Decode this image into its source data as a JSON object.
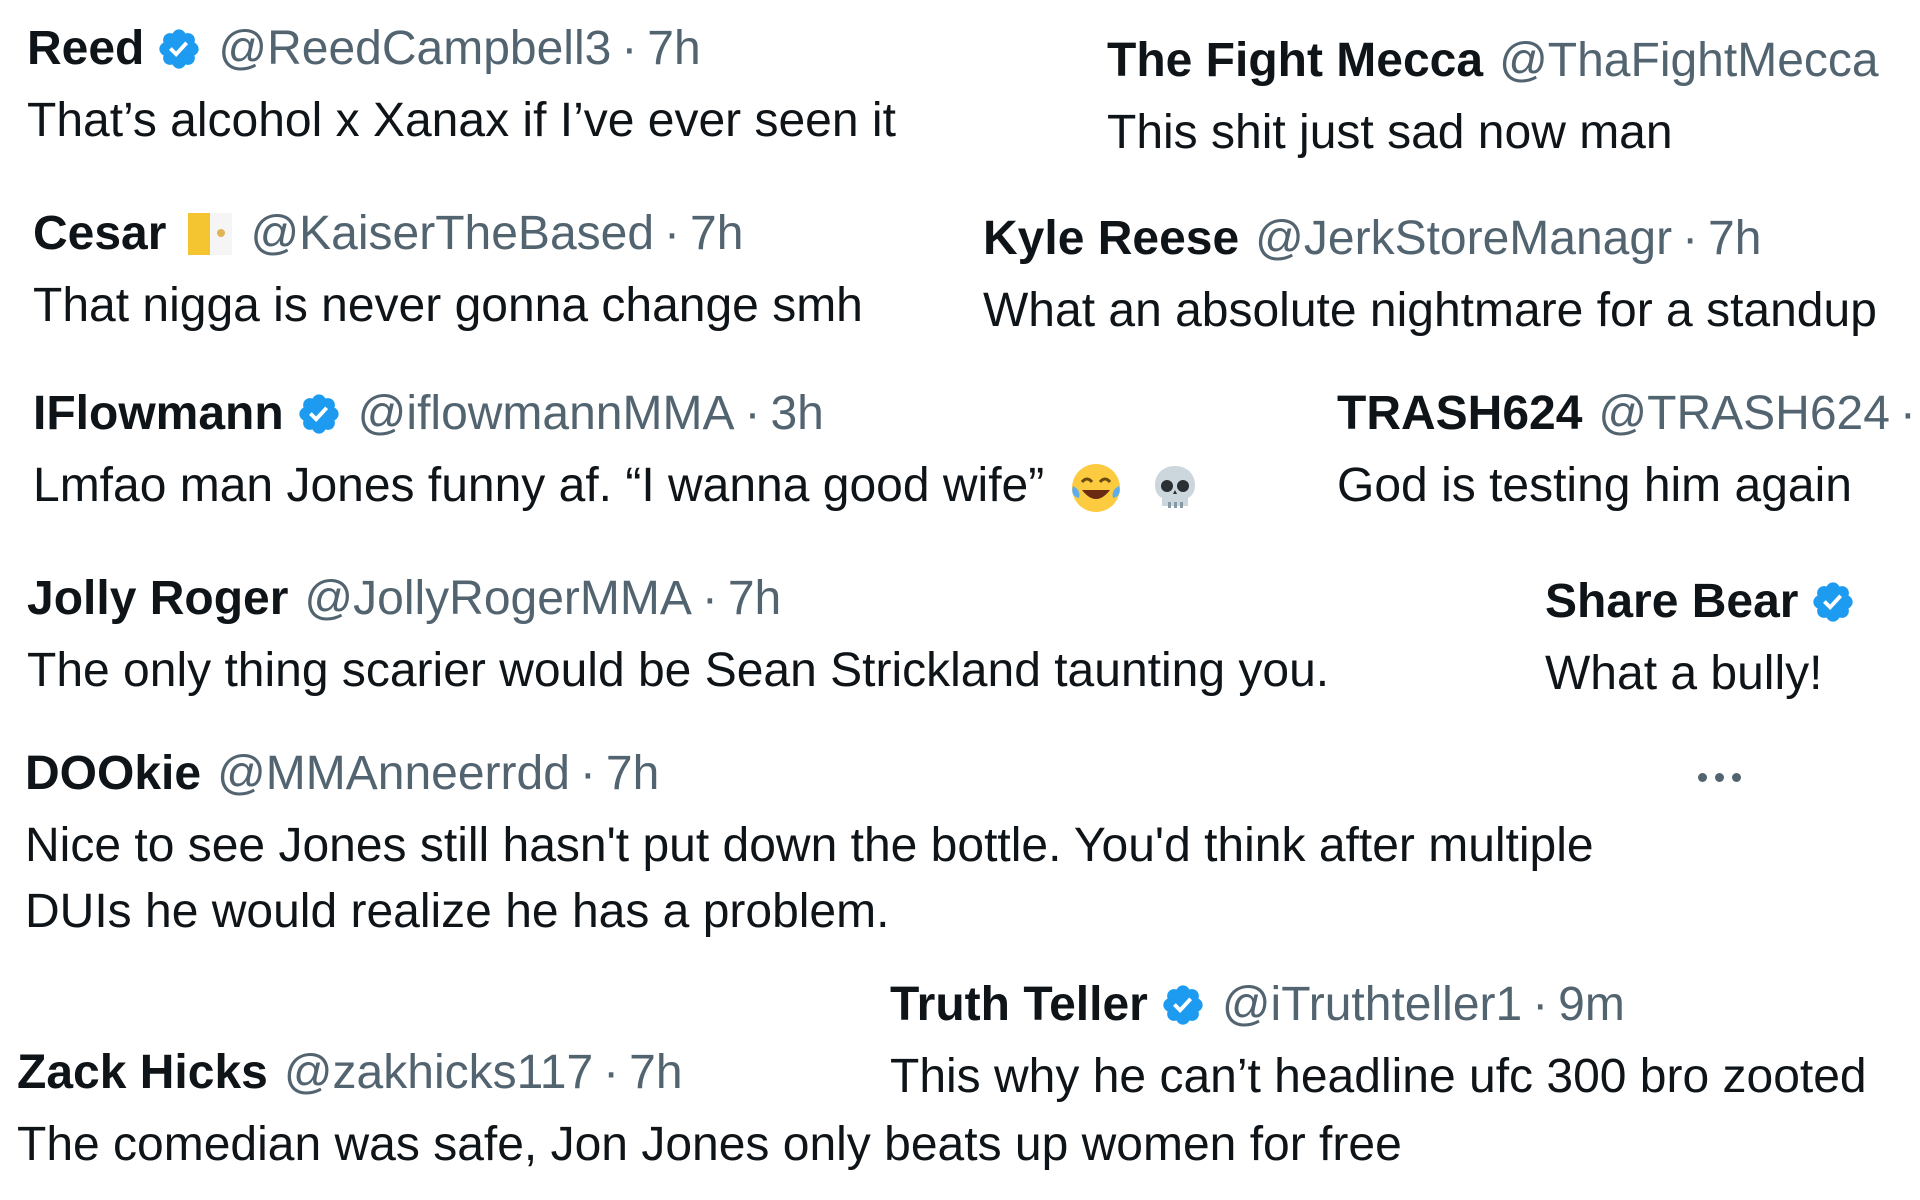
{
  "tweets": [
    {
      "name": "Reed",
      "verified": true,
      "handle": "@ReedCampbell3",
      "sep": "·",
      "time": "7h",
      "text": "That’s alcohol x Xanax if I’ve ever seen it"
    },
    {
      "name": "The Fight Mecca",
      "verified": false,
      "handle": "@ThaFightMecca",
      "text": "This shit just sad now man"
    },
    {
      "name": "Cesar",
      "verified": false,
      "flag": "vatican-flag-icon",
      "handle": "@KaiserTheBased",
      "sep": "·",
      "time": "7h",
      "text": "That nigga is never gonna change smh"
    },
    {
      "name": "Kyle Reese",
      "verified": false,
      "handle": "@JerkStoreManagr",
      "sep": "·",
      "time": "7h",
      "text": "What an absolute nightmare for a standup"
    },
    {
      "name": "IFlowmann",
      "verified": true,
      "handle": "@iflowmannMMA",
      "sep": "·",
      "time": "3h",
      "text": "Lmfao man Jones funny af. “I wanna good wife”",
      "emojis": [
        "tears-of-joy-emoji-icon",
        "skull-emoji-icon"
      ]
    },
    {
      "name": "TRASH624",
      "verified": false,
      "handle": "@TRASH624",
      "sep": "·",
      "text": "God is testing him again"
    },
    {
      "name": "Jolly Roger",
      "verified": false,
      "handle": "@JollyRogerMMA",
      "sep": "·",
      "time": "7h",
      "text": "The only thing scarier would be Sean Strickland taunting you."
    },
    {
      "name": "Share Bear",
      "verified": true,
      "text": "What a bully!"
    },
    {
      "name": "DOOkie",
      "verified": false,
      "handle": "@MMAnneerrdd",
      "sep": "·",
      "time": "7h",
      "text_line1": "Nice to see Jones still hasn't put down the bottle. You'd think after multiple",
      "text_line2": "DUIs he would realize he has a problem."
    },
    {
      "name": "Truth Teller",
      "verified": true,
      "handle": "@iTruthteller1",
      "sep": "·",
      "time": "9m",
      "text": "This why he can’t headline ufc 300 bro zooted"
    },
    {
      "name": "Zack Hicks",
      "verified": false,
      "handle": "@zakhicks117",
      "sep": "·",
      "time": "7h",
      "text": "The comedian was safe, Jon Jones only beats up women for free"
    }
  ],
  "colors": {
    "text": "#0f1419",
    "secondary": "#536471",
    "verified": "#1d9bf0"
  },
  "icons": {
    "verified": "verified-badge-icon",
    "more": "more-options-icon"
  }
}
